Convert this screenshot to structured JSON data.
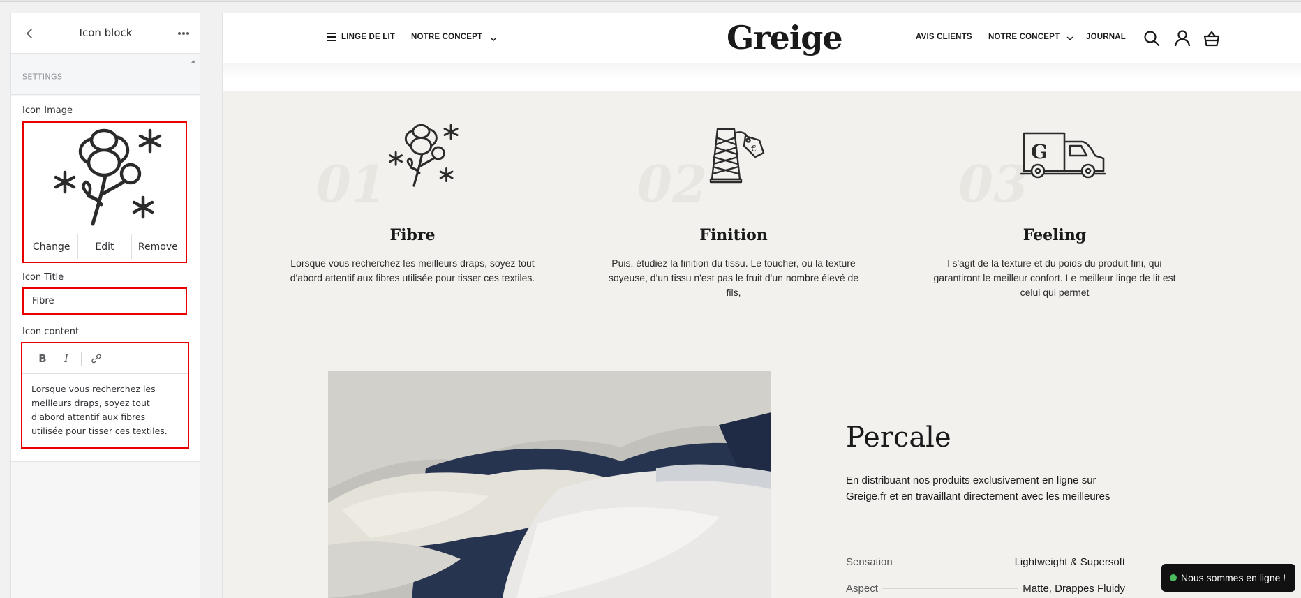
{
  "editor": {
    "title": "Icon block",
    "settings_heading": "SETTINGS",
    "icon_image": {
      "label": "Icon Image",
      "image_icon": "cotton-flower-icon",
      "actions": {
        "change": "Change",
        "edit": "Edit",
        "remove": "Remove"
      }
    },
    "icon_title": {
      "label": "Icon Title",
      "value": "Fibre"
    },
    "icon_content": {
      "label": "Icon content",
      "toolbar": {
        "bold": "B",
        "italic": "I",
        "link_icon": "link-icon"
      },
      "value": "Lorsque vous recherchez les meilleurs draps, soyez tout d'abord attentif aux fibres utilisée pour tisser ces textiles."
    },
    "highlight_color": "#e60000"
  },
  "store": {
    "nav": {
      "left": [
        {
          "label": "LINGE DE LIT"
        },
        {
          "label": "NOTRE CONCEPT"
        }
      ],
      "logo": "Greige",
      "right": [
        {
          "label": "AVIS CLIENTS"
        },
        {
          "label": "NOTRE CONCEPT"
        },
        {
          "label": "JOURNAL"
        }
      ]
    },
    "features": [
      {
        "number": "01",
        "icon": "cotton-flower-icon",
        "title": "Fibre",
        "text": "Lorsque vous recherchez les meilleurs draps, soyez tout d'abord attentif aux fibres utilisée pour tisser ces textiles."
      },
      {
        "number": "02",
        "icon": "thread-spool-icon",
        "title": "Finition",
        "text": "Puis, étudiez la finition du tissu. Le toucher, ou la texture soyeuse, d'un tissu n'est pas le fruit d'un nombre élevé de fils,"
      },
      {
        "number": "03",
        "icon": "delivery-truck-icon",
        "title": "Feeling",
        "text": "l s'agit de la texture et du poids du produit fini, qui garantiront le meilleur confort. Le meilleur linge de lit est celui qui permet"
      }
    ],
    "percale": {
      "title": "Percale",
      "text": "En distribuant nos produits exclusivement en ligne sur Greige.fr et en travaillant directement avec les meilleures",
      "specs": [
        {
          "label": "Sensation",
          "value": "Lightweight & Supersoft"
        },
        {
          "label": "Aspect",
          "value": "Matte, Drappes Fluidy"
        }
      ]
    },
    "chat": {
      "label": "Nous sommes en ligne !",
      "status_color": "#4cbb5e"
    }
  }
}
